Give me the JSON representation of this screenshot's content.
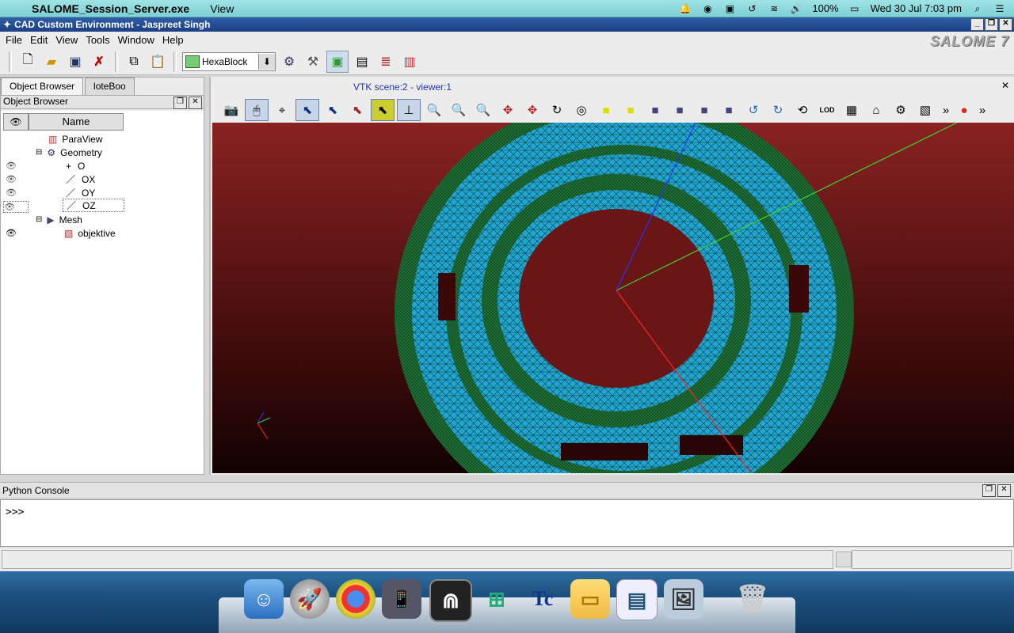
{
  "mac_menubar": {
    "app_name": "SALOME_Session_Server.exe",
    "menu": "View",
    "battery": "100%",
    "datetime": "Wed 30 Jul  7:03 pm"
  },
  "window": {
    "title": "CAD Custom Environment - Jaspreet Singh",
    "logo": "SALOME 7"
  },
  "menus": [
    "File",
    "Edit",
    "View",
    "Tools",
    "Window",
    "Help"
  ],
  "toolbar": {
    "module_combo": "HexaBlock"
  },
  "left_panel": {
    "tabs": [
      "Object Browser",
      "loteBoo"
    ],
    "title": "Object Browser",
    "column_name": "Name",
    "tree": [
      {
        "label": "ParaView",
        "icon": "paraview-icon"
      },
      {
        "label": "Geometry",
        "icon": "geometry-icon"
      },
      {
        "label": "O",
        "icon": "point-icon"
      },
      {
        "label": "OX",
        "icon": "vector-icon"
      },
      {
        "label": "OY",
        "icon": "vector-icon"
      },
      {
        "label": "OZ",
        "icon": "vector-icon"
      },
      {
        "label": "Mesh",
        "icon": "mesh-icon"
      },
      {
        "label": "objektive",
        "icon": "mesh-object-icon"
      }
    ]
  },
  "viewer": {
    "title": "VTK scene:2 - viewer:1"
  },
  "console": {
    "title": "Python Console",
    "prompt": ">>>"
  }
}
